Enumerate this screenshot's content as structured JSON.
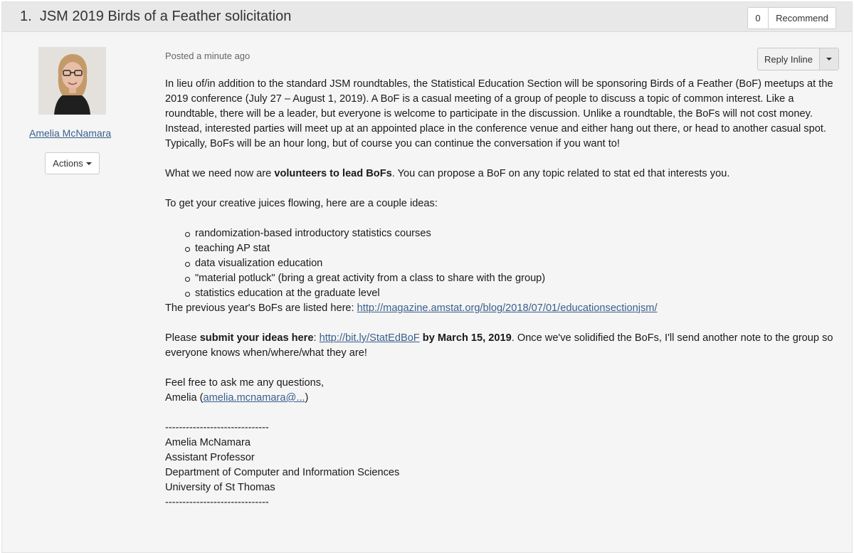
{
  "thread": {
    "number": "1.",
    "title": "JSM 2019 Birds of a Feather solicitation",
    "recommend_count": "0",
    "recommend_label": "Recommend"
  },
  "author": {
    "name": "Amelia McNamara",
    "actions_label": "Actions"
  },
  "post": {
    "posted": "Posted a minute ago",
    "reply_label": "Reply Inline",
    "intro": "In lieu of/in addition to the standard JSM roundtables, the Statistical Education Section will be sponsoring Birds of a Feather (BoF) meetups at the 2019 conference (July 27 – August 1, 2019). A BoF is a casual meeting of a group of people to discuss a topic of common interest. Like a roundtable, there will be a leader, but everyone is welcome to participate in the discussion. Unlike a roundtable, the BoFs will not cost money. Instead, interested parties will meet up at an appointed place in the conference venue and either hang out there, or head to another casual spot. Typically, BoFs will be an hour long, but of course you can continue the conversation if you want to!",
    "need_pre": "What we need now are ",
    "need_bold": "volunteers to lead BoFs",
    "need_post": ". You can propose a BoF on any topic related to stat ed that interests you.",
    "ideas_intro": "To get your creative juices flowing, here are a couple ideas:",
    "ideas": [
      "randomization-based introductory statistics courses",
      "teaching AP stat",
      "data visualization education",
      "\"material potluck\" (bring a great activity from a class to share with the group)",
      "statistics education at the graduate level"
    ],
    "previous_pre": "The previous year's BoFs are listed here: ",
    "previous_link": "http://magazine.amstat.org/blog/2018/07/01/educationsectionjsm/",
    "submit_pre": "Please ",
    "submit_bold": "submit your ideas here",
    "submit_colon": ": ",
    "submit_link": "http://bit.ly/StatEdBoF",
    "submit_date": " by March 15, 2019",
    "submit_post": ". Once we've solidified the BoFs, I'll send another note to the group so everyone knows when/where/what they are!",
    "closing": "Feel free to ask me any questions,",
    "sign_pre": "Amelia (",
    "sign_email": "amelia.mcnamara@...",
    "sign_post": ")",
    "separator": "------------------------------",
    "sig_name": "Amelia McNamara",
    "sig_title": "Assistant Professor",
    "sig_dept": "Department of Computer and Information Sciences",
    "sig_univ": "University of St Thomas",
    "separator_end": "------------------------------"
  }
}
